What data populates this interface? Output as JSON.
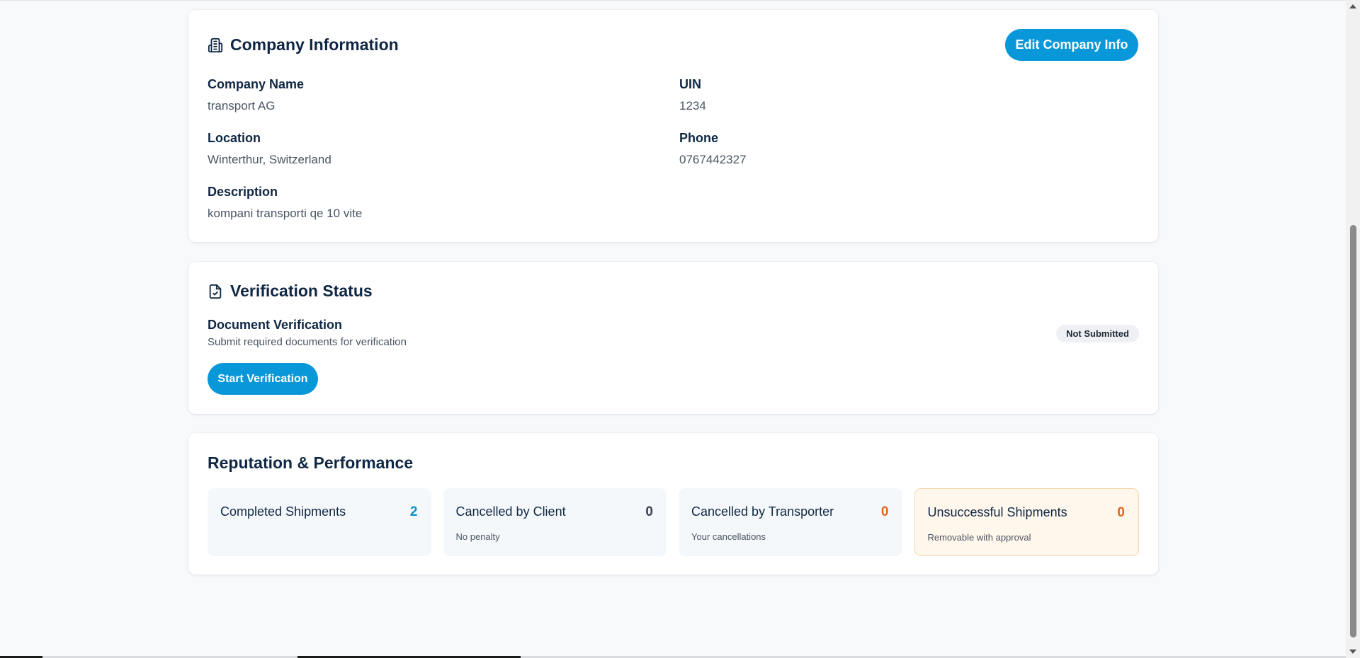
{
  "company": {
    "title": "Company Information",
    "edit_label": "Edit Company Info",
    "fields": {
      "name": {
        "label": "Company Name",
        "value": "transport AG"
      },
      "uin": {
        "label": "UIN",
        "value": "1234"
      },
      "location": {
        "label": "Location",
        "value": "Winterthur, Switzerland"
      },
      "phone": {
        "label": "Phone",
        "value": "0767442327"
      },
      "description": {
        "label": "Description",
        "value": "kompani transporti qe 10 vite"
      }
    }
  },
  "verification": {
    "title": "Verification Status",
    "doc_title": "Document Verification",
    "doc_subtitle": "Submit required documents for verification",
    "status_badge": "Not Submitted",
    "start_label": "Start Verification"
  },
  "reputation": {
    "title": "Reputation & Performance",
    "stats": [
      {
        "label": "Completed Shipments",
        "value": "2",
        "sub": "",
        "color": "#0e8fc5"
      },
      {
        "label": "Cancelled by Client",
        "value": "0",
        "sub": "No penalty",
        "color": "#374151"
      },
      {
        "label": "Cancelled by Transporter",
        "value": "0",
        "sub": "Your cancellations",
        "color": "#e0661b"
      },
      {
        "label": "Unsuccessful Shipments",
        "value": "0",
        "sub": "Removable with approval",
        "color": "#e0661b"
      }
    ]
  },
  "icons": {
    "company": "building-icon",
    "verification": "file-check-icon"
  },
  "colors": {
    "accent": "#0898d9",
    "heading": "#0f2744",
    "muted": "#4a5563",
    "warning_bg": "#fff6ec",
    "warning_value": "#e0661b",
    "success_value": "#0e8fc5"
  }
}
